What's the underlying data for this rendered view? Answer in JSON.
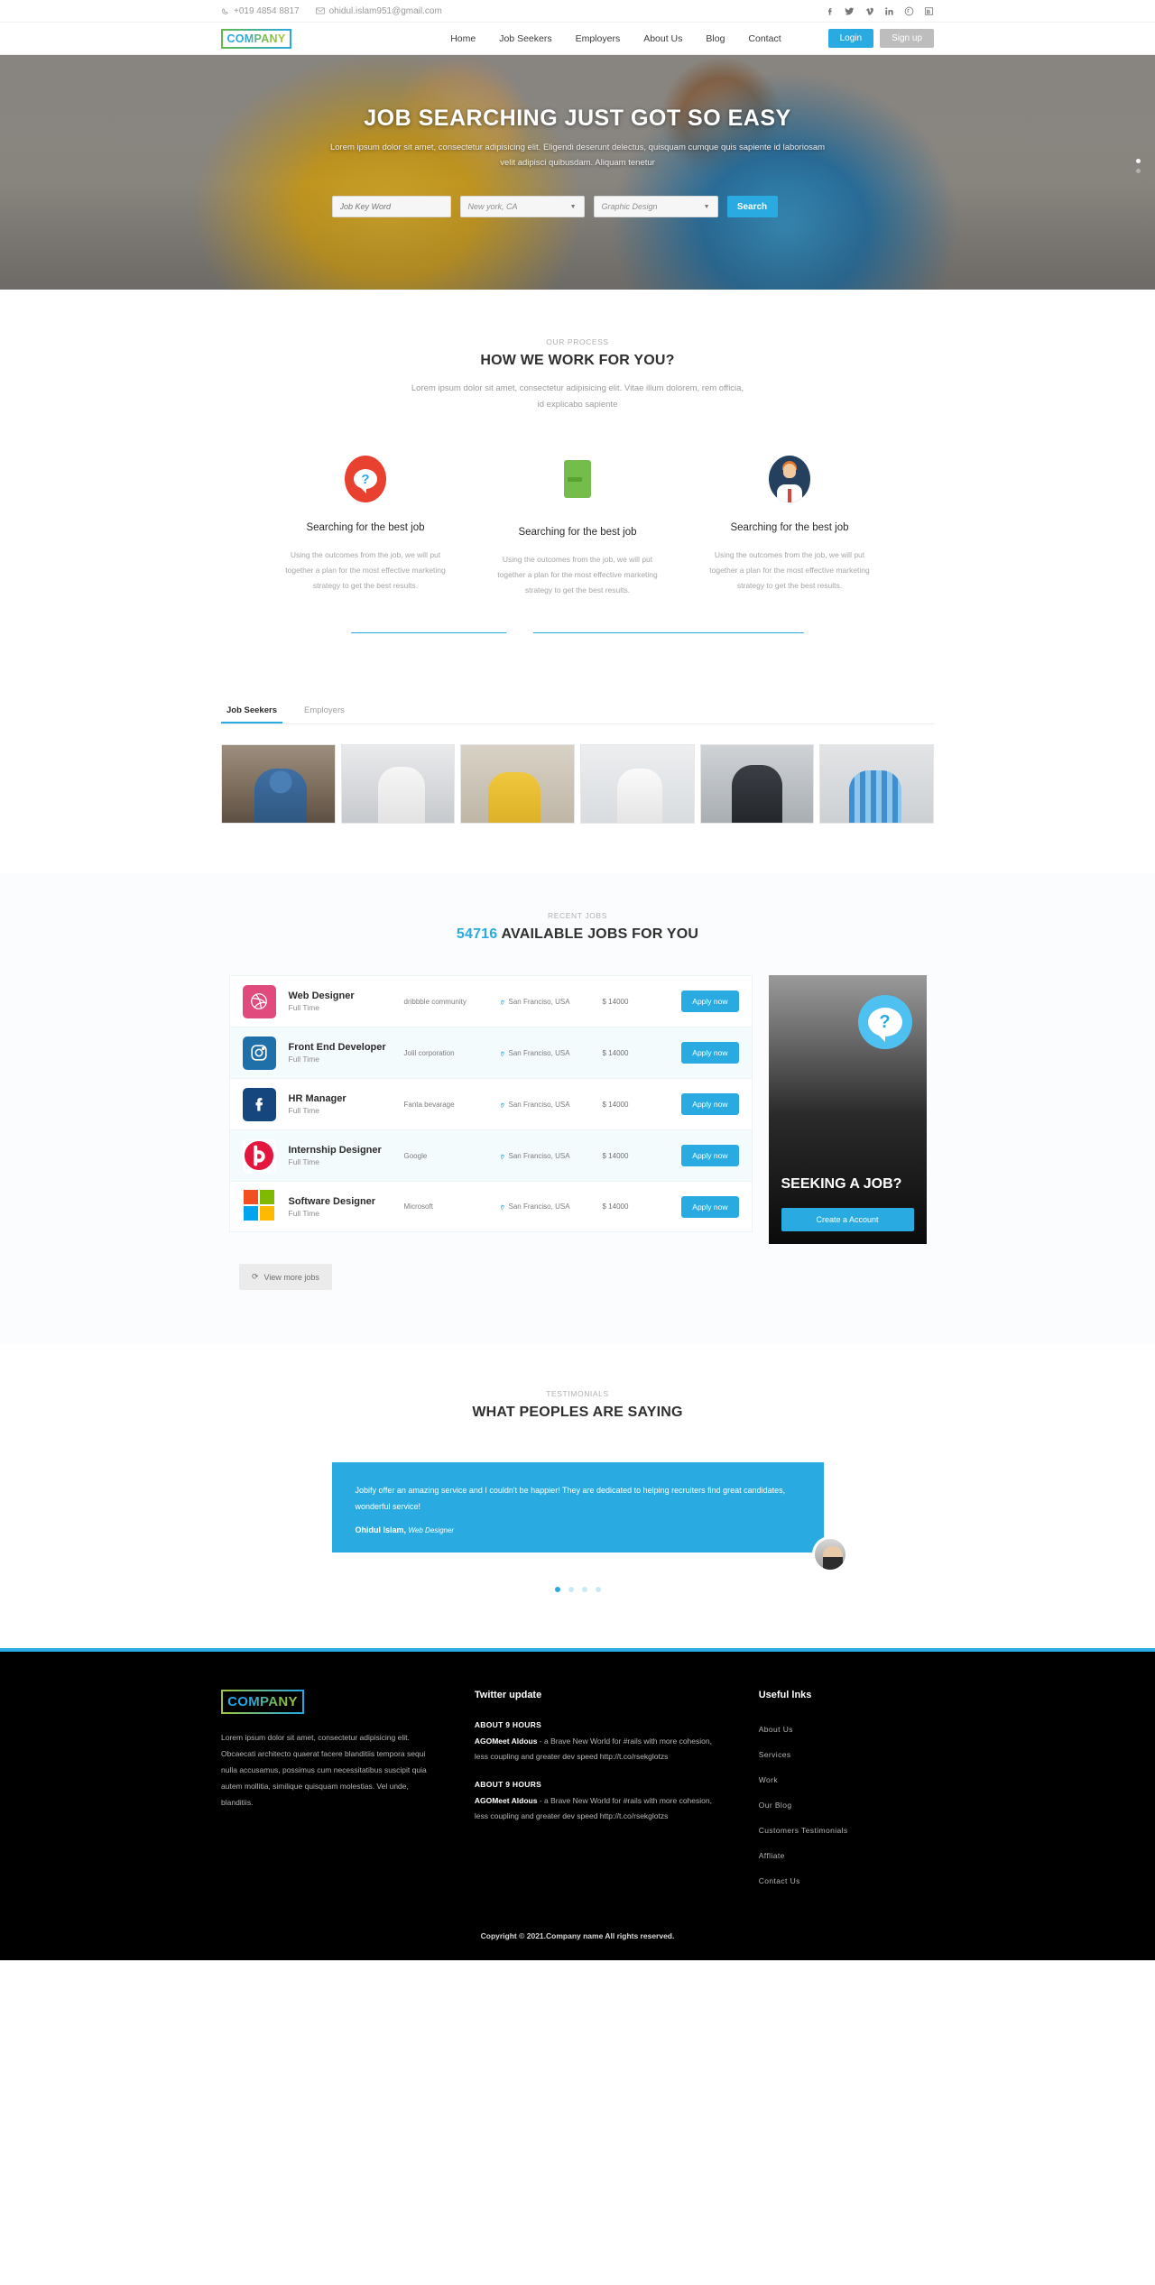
{
  "topbar": {
    "phone": "+019 4854 8817",
    "email": "ohidul.islam951@gmail.com",
    "socials": [
      "facebook-icon",
      "twitter-icon",
      "vimeo-icon",
      "linkedin-icon",
      "pinterest-icon",
      "behance-icon"
    ]
  },
  "nav": {
    "logo": "COMPANY",
    "items": [
      {
        "label": "Home"
      },
      {
        "label": "Job Seekers"
      },
      {
        "label": "Employers"
      },
      {
        "label": "About Us"
      },
      {
        "label": "Blog"
      },
      {
        "label": "Contact"
      }
    ],
    "login": "Login",
    "signup": "Sign up"
  },
  "hero": {
    "title": "JOB SEARCHING JUST GOT SO EASY",
    "subtitle": "Lorem ipsum dolor sit amet, consectetur adipisicing elit. Eligendi deserunt delectus, quisquam cumque quis sapiente id laboriosam velit adipisci quibusdam. Aliquam tenetur",
    "search": {
      "keyword_placeholder": "Job Key Word",
      "location_value": "New york, CA",
      "category_value": "Graphic Design",
      "button": "Search"
    }
  },
  "process": {
    "eyebrow": "OUR PROCESS",
    "title": "HOW WE WORK FOR YOU?",
    "lead_line1": "Lorem ipsum dolor sit amet, consectetur adipisicing elit. Vitae illum dolorem, rem officia,",
    "lead_line2": "id explicabo sapiente",
    "cards": [
      {
        "icon": "question-bubble-icon",
        "title": "Searching for the best job",
        "text": "Using the outcomes from the job, we will put together a plan for the most effective marketing strategy to get the best results."
      },
      {
        "icon": "document-icon",
        "title": "Searching for the best job",
        "text": "Using the outcomes from the job, we will put together a plan for the most effective marketing strategy to get the best results."
      },
      {
        "icon": "person-avatar-icon",
        "title": "Searching for the best job",
        "text": "Using the outcomes from the job, we will put together a plan for the most effective marketing strategy to get the best results."
      }
    ]
  },
  "tabsection": {
    "tabs": [
      {
        "label": "Job Seekers",
        "active": true
      },
      {
        "label": "Employers",
        "active": false
      }
    ],
    "gallery_count": 6
  },
  "jobs": {
    "eyebrow": "RECENT JOBS",
    "count": "54716",
    "title_rest": "AVAILABLE JOBS FOR YOU",
    "apply_label": "Apply now",
    "view_more": "View more jobs",
    "items": [
      {
        "icon": "dribbble-icon",
        "title": "Web Designer",
        "type": "Full Time",
        "company": "dribbble community",
        "location": "San Franciso, USA",
        "salary": "$ 14000"
      },
      {
        "icon": "instagram-icon",
        "title": "Front End Developer",
        "type": "Full Time",
        "company": "Jolil corporation",
        "location": "San Franciso, USA",
        "salary": "$ 14000"
      },
      {
        "icon": "facebook-icon",
        "title": "HR Manager",
        "type": "Full Time",
        "company": "Fanta bevarage",
        "location": "San Franciso, USA",
        "salary": "$ 14000"
      },
      {
        "icon": "beats-icon",
        "title": "Internship Designer",
        "type": "Full Time",
        "company": "Google",
        "location": "San Franciso, USA",
        "salary": "$ 14000"
      },
      {
        "icon": "microsoft-icon",
        "title": "Software Designer",
        "type": "Full Time",
        "company": "Microsoft",
        "location": "San Franciso, USA",
        "salary": "$ 14000"
      }
    ],
    "seeking": {
      "title": "SEEKING A JOB?",
      "button": "Create a Account"
    }
  },
  "testimonials": {
    "eyebrow": "TESTIMONIALS",
    "title": "WHAT PEOPLES ARE SAYING",
    "quote": "Jobify offer an amazing service and I couldn't be happier! They are dedicated to helping recruiters find great candidates, wonderful service!",
    "author": "Ohidul Islam,",
    "role": "Web Designer",
    "dots": 4,
    "active_dot": 0
  },
  "footer": {
    "logo": "COMPANY",
    "about": "Lorem ipsum dolor sit amet, consectetur adipisicing elit. Obcaecati architecto quaerat facere blanditiis tempora sequi nulla accusamus, possimus cum necessitatibus suscipit quia autem mollitia, similique quisquam molestias. Vel unde, blanditiis.",
    "twitter_head": "Twitter update",
    "tweets": [
      {
        "time": "ABOUT 9 HOURS",
        "handle": "AGOMeet Aldous",
        "text": " - a Brave New World for #rails with more cohesion, less coupling and greater dev speed http://t.co/rsekglotzs"
      },
      {
        "time": "ABOUT 9 HOURS",
        "handle": "AGOMeet Aldous",
        "text": " - a Brave New World for #rails with more cohesion, less coupling and greater dev speed http://t.co/rsekglotzs"
      }
    ],
    "links_head": "Useful lnks",
    "links": [
      {
        "label": "About Us"
      },
      {
        "label": "Services"
      },
      {
        "label": "Work"
      },
      {
        "label": "Our Blog"
      },
      {
        "label": "Customers Testimonials"
      },
      {
        "label": "Affliate"
      },
      {
        "label": "Contact Us"
      }
    ],
    "copyright": "Copyright © 2021.Company name All rights reserved."
  },
  "colors": {
    "accent": "#29abe2",
    "dark": "#000000",
    "red": "#e8412f",
    "green": "#74bd4a",
    "navy": "#24405e"
  }
}
